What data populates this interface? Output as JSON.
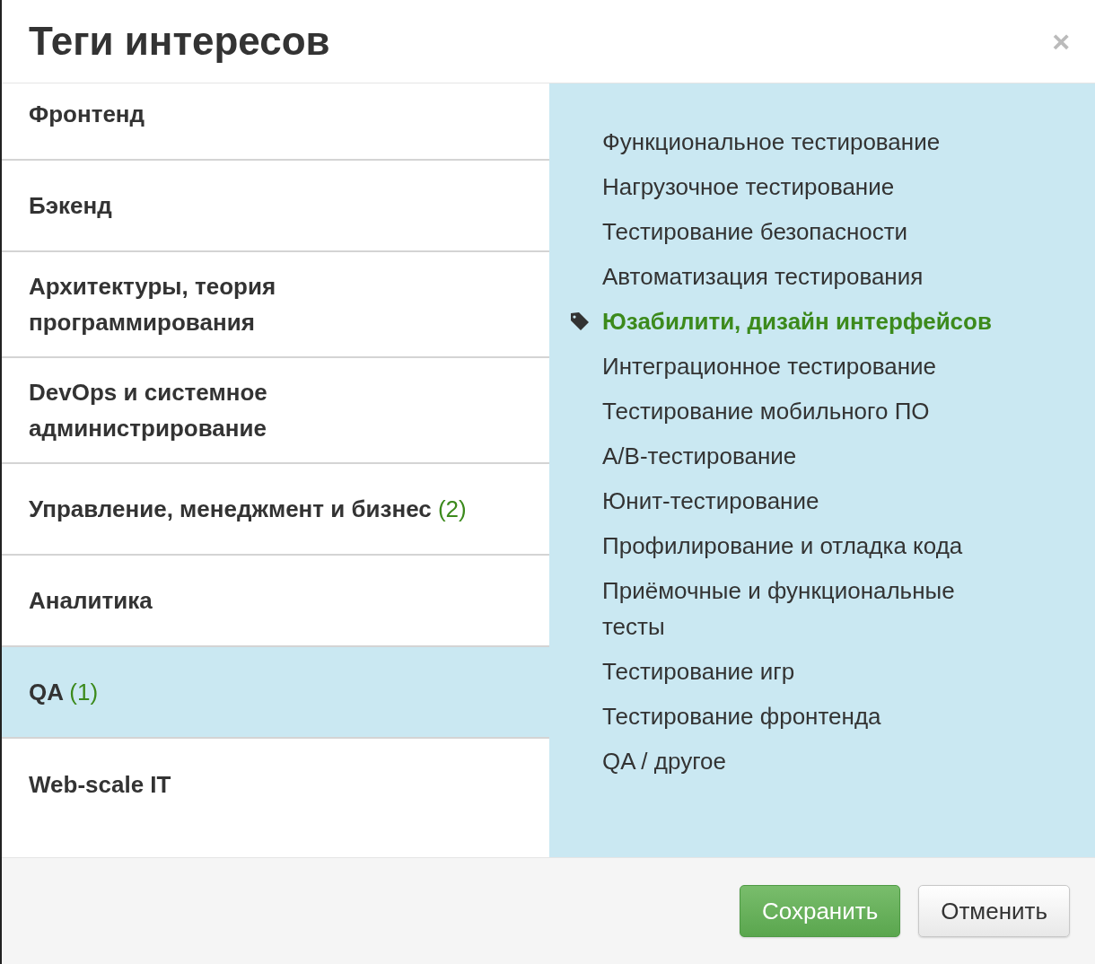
{
  "dialog": {
    "title": "Теги интересов",
    "close": "×"
  },
  "categories": [
    {
      "label": "Фронтенд",
      "selected": false
    },
    {
      "label": "Бэкенд",
      "selected": false
    },
    {
      "label": "Архитектуры, теория программирования",
      "selected": false
    },
    {
      "label": "DevOps и системное администрирование",
      "selected": false
    },
    {
      "label": "Управление, менеджмент и бизнес",
      "count": "(2)",
      "selected": false
    },
    {
      "label": "Аналитика",
      "selected": false
    },
    {
      "label": "QA",
      "count": "(1)",
      "selected": true
    },
    {
      "label": "Web-scale IT",
      "selected": false
    }
  ],
  "tags": [
    {
      "label": "Функциональное тестирование",
      "selected": false
    },
    {
      "label": "Нагрузочное тестирование",
      "selected": false
    },
    {
      "label": "Тестирование безопасности",
      "selected": false
    },
    {
      "label": "Автоматизация тестирования",
      "selected": false
    },
    {
      "label": "Юзабилити, дизайн интерфейсов",
      "selected": true
    },
    {
      "label": "Интеграционное тестирование",
      "selected": false
    },
    {
      "label": "Тестирование мобильного ПО",
      "selected": false
    },
    {
      "label": "A/B-тестирование",
      "selected": false
    },
    {
      "label": "Юнит-тестирование",
      "selected": false
    },
    {
      "label": "Профилирование и отладка кода",
      "selected": false
    },
    {
      "label": "Приёмочные и функциональные тесты",
      "selected": false
    },
    {
      "label": "Тестирование игр",
      "selected": false
    },
    {
      "label": "Тестирование фронтенда",
      "selected": false
    },
    {
      "label": "QA / другое",
      "selected": false
    }
  ],
  "buttons": [
    {
      "label": "Сохранить",
      "kind": "primary"
    },
    {
      "label": "Отменить",
      "kind": "default"
    }
  ]
}
